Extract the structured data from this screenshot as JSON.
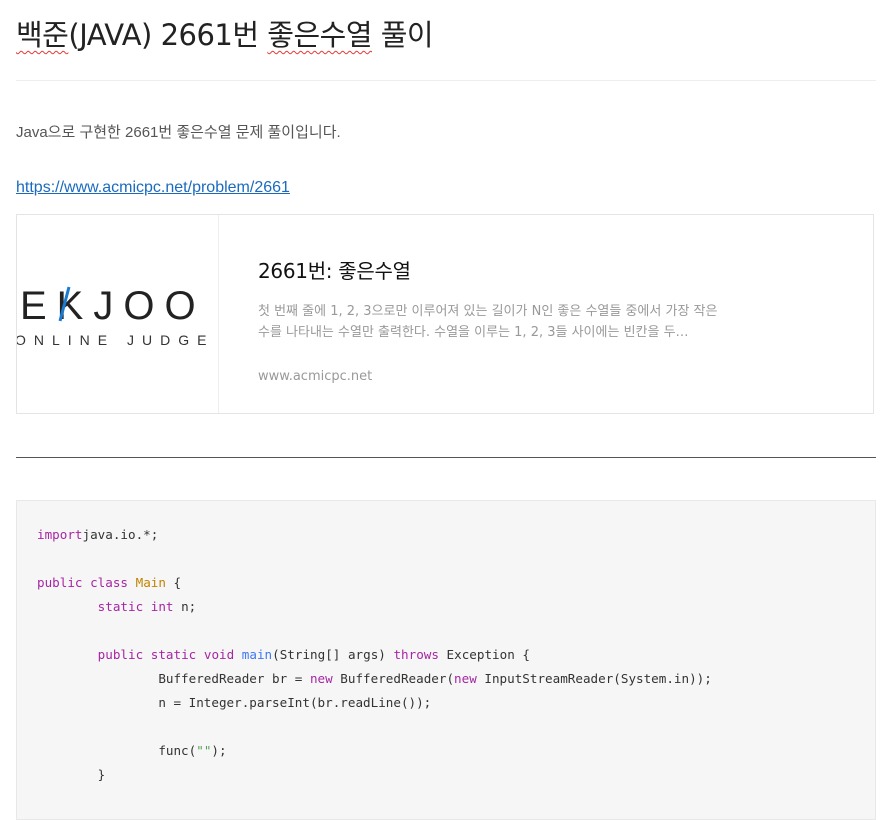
{
  "post": {
    "title_prefix": "백준",
    "title_middle": "(JAVA) 2661번 ",
    "title_highlight": "좋은수열",
    "title_suffix": " 풀이",
    "intro": "Java으로 구현한 2661번 좋은수열 문제 풀이입니다.",
    "link": "https://www.acmicpc.net/problem/2661"
  },
  "card": {
    "logo_top": "EKJOO",
    "logo_bottom": "ONLINE JUDGE",
    "logo_accent_color": "#1a7bd0",
    "title": "2661번: 좋은수열",
    "description": "첫 번째 줄에 1, 2, 3으로만 이루어져 있는 길이가 N인 좋은 수열들 중에서 가장 작은 수를 나타내는 수열만 출력한다. 수열을 이루는 1, 2, 3들 사이에는 빈칸을 두…",
    "host": "www.acmicpc.net"
  },
  "code": {
    "lines": [
      [
        [
          "kw",
          "import"
        ],
        [
          "",
          "java.io.*;"
        ]
      ],
      [],
      [
        [
          "kw",
          "public"
        ],
        [
          "",
          " "
        ],
        [
          "kw",
          "class"
        ],
        [
          "",
          " "
        ],
        [
          "cls",
          "Main"
        ],
        [
          "",
          " {"
        ]
      ],
      [
        [
          "",
          "        "
        ],
        [
          "kw",
          "static"
        ],
        [
          "",
          " "
        ],
        [
          "kw",
          "int"
        ],
        [
          "",
          " n;"
        ]
      ],
      [],
      [
        [
          "",
          "        "
        ],
        [
          "kw",
          "public"
        ],
        [
          "",
          " "
        ],
        [
          "kw",
          "static"
        ],
        [
          "",
          " "
        ],
        [
          "kw",
          "void"
        ],
        [
          "",
          " "
        ],
        [
          "fn",
          "main"
        ],
        [
          "",
          "(String[] args) "
        ],
        [
          "kw",
          "throws"
        ],
        [
          "",
          " Exception {"
        ]
      ],
      [
        [
          "",
          "                BufferedReader br = "
        ],
        [
          "kw",
          "new"
        ],
        [
          "",
          " BufferedReader("
        ],
        [
          "kw",
          "new"
        ],
        [
          "",
          " InputStreamReader(System.in));"
        ]
      ],
      [
        [
          "",
          "                n = Integer.parseInt(br.readLine());"
        ]
      ],
      [],
      [
        [
          "",
          "                func("
        ],
        [
          "str",
          "\"\""
        ],
        [
          "",
          ");"
        ]
      ],
      [
        [
          "",
          "        }"
        ]
      ],
      []
    ]
  }
}
